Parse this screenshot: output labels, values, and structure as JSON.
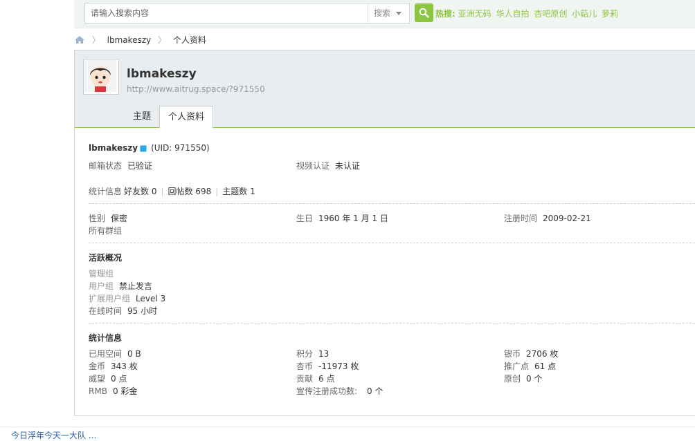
{
  "search": {
    "placeholder": "请输入搜索内容",
    "type_label": "搜索",
    "hot_label": "热搜:",
    "hot_terms": [
      "亚洲无码",
      "华人自拍",
      "杏吧原创",
      "小萜儿",
      "萝莉"
    ]
  },
  "breadcrumb": {
    "home_icon": "home-icon",
    "user": "lbmakeszy",
    "page": "个人资料"
  },
  "profile": {
    "username": "lbmakeszy",
    "url": "http://www.aitrug.space/?971550",
    "tabs": [
      "主题",
      "个人资料"
    ],
    "active_tab": "个人资料"
  },
  "info": {
    "name": "lbmakeszy",
    "uid": "(UID: 971550)",
    "email_label": "邮箱状态",
    "email_value": "已验证",
    "video_label": "视频认证",
    "video_value": "未认证",
    "stats_label": "统计信息",
    "friends": "好友数 0",
    "replies": "回帖数 698",
    "topics": "主题数 1",
    "gender_label": "性别",
    "gender_value": "保密",
    "birthday_label": "生日",
    "birthday_value": "1960 年 1 月 1 日",
    "register_label": "注册时间",
    "register_value": "2009-02-21",
    "groups_label": "所有群组"
  },
  "activity": {
    "title": "活跃概况",
    "admin_group_label": "管理组",
    "user_group_label": "用户组",
    "user_group_value": "禁止发言",
    "ext_group_label": "扩展用户组",
    "ext_group_value": "Level 3",
    "online_label": "在线时间",
    "online_value": "95 小时"
  },
  "statistics": {
    "title": "统计信息",
    "col1": [
      {
        "label": "已用空间",
        "value": "0 B"
      },
      {
        "label": "金币",
        "value": "343 枚"
      },
      {
        "label": "威望",
        "value": "0 点"
      },
      {
        "label": "RMB",
        "value": "0 彩金"
      }
    ],
    "col2": [
      {
        "label": "积分",
        "value": "13"
      },
      {
        "label": "杏币",
        "value": "-11973 枚"
      },
      {
        "label": "贡献",
        "value": "6 点"
      },
      {
        "label": "宣传注册成功数:",
        "value": "0 个"
      }
    ],
    "col3": [
      {
        "label": "银币",
        "value": "2706 枚"
      },
      {
        "label": "推广点",
        "value": "61 点"
      },
      {
        "label": "原创",
        "value": "0 个"
      }
    ]
  },
  "footer": {
    "text": "今日浮年今天一大队 ..."
  },
  "colors": {
    "accent": "#8cc63f",
    "header_bg": "#e8edf1",
    "online": "#2ea7e0"
  }
}
